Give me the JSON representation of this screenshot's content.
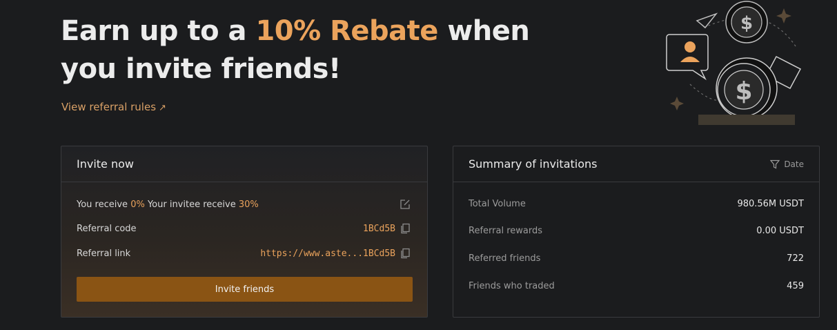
{
  "hero": {
    "title_part1": "Earn up to a ",
    "title_accent": "10% Rebate",
    "title_part2": " when you invite friends!",
    "rules_link": "View referral rules",
    "rules_arrow": "↗"
  },
  "invite": {
    "title": "Invite now",
    "receive_prefix": "You receive ",
    "receive_value": "0%",
    "invitee_prefix": " Your invitee receive ",
    "invitee_value": "30%",
    "code_label": "Referral code",
    "code_value": "1BCd5B",
    "link_label": "Referral link",
    "link_value": "https://www.aste...1BCd5B",
    "button": "Invite friends"
  },
  "summary": {
    "title": "Summary of invitations",
    "filter": "Date",
    "rows": [
      {
        "label": "Total Volume",
        "value": "980.56M USDT"
      },
      {
        "label": "Referral rewards",
        "value": "0.00 USDT"
      },
      {
        "label": "Referred friends",
        "value": "722"
      },
      {
        "label": "Friends who traded",
        "value": "459"
      }
    ]
  },
  "illustration": {
    "coin_symbol": "$"
  },
  "colors": {
    "accent": "#eba35c",
    "button": "#8a5414",
    "background": "#1b1c1e"
  }
}
